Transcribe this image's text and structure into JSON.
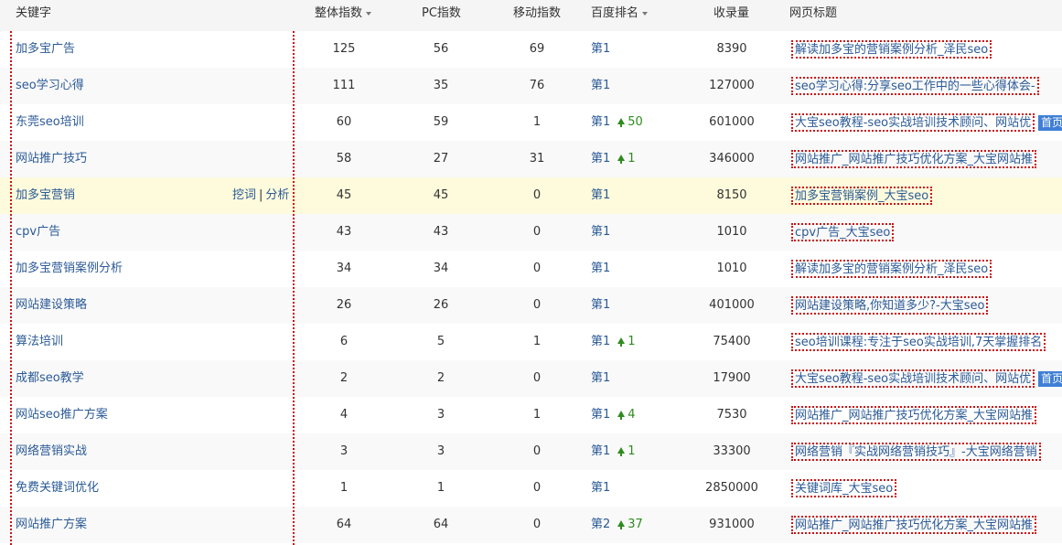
{
  "header": {
    "keyword": "关键字",
    "overall": "整体指数",
    "pc": "PC指数",
    "mobile": "移动指数",
    "rank": "百度排名",
    "indexed": "收录量",
    "page_title": "网页标题"
  },
  "row_actions": {
    "mine": "挖词",
    "sep": "|",
    "analyze": "分析"
  },
  "home_badge": "首页",
  "colors": {
    "link": "#2b5a96",
    "up": "#2e8b1e",
    "highlight": "#fdfbdc",
    "dotted_border": "#cc1111",
    "badge": "#3f7fd6"
  },
  "rows": [
    {
      "keyword": "加多宝广告",
      "overall": "125",
      "pc": "56",
      "mobile": "69",
      "rank": "第1",
      "change": "",
      "indexed": "8390",
      "title": "解读加多宝的营销案例分析_泽民seo",
      "home": false
    },
    {
      "keyword": "seo学习心得",
      "overall": "111",
      "pc": "35",
      "mobile": "76",
      "rank": "第1",
      "change": "",
      "indexed": "127000",
      "title": "seo学习心得:分享seo工作中的一些心得体会-",
      "home": false
    },
    {
      "keyword": "东莞seo培训",
      "overall": "60",
      "pc": "59",
      "mobile": "1",
      "rank": "第1",
      "change": "50",
      "indexed": "601000",
      "title": "大宝seo教程-seo实战培训技术顾问、网站优",
      "home": true
    },
    {
      "keyword": "网站推广技巧",
      "overall": "58",
      "pc": "27",
      "mobile": "31",
      "rank": "第1",
      "change": "1",
      "indexed": "346000",
      "title": "网站推广_网站推广技巧优化方案_大宝网站推",
      "home": false
    },
    {
      "keyword": "加多宝营销",
      "overall": "45",
      "pc": "45",
      "mobile": "0",
      "rank": "第1",
      "change": "",
      "indexed": "8150",
      "title": "加多宝营销案例_大宝seo",
      "home": false
    },
    {
      "keyword": "cpv广告",
      "overall": "43",
      "pc": "43",
      "mobile": "0",
      "rank": "第1",
      "change": "",
      "indexed": "1010",
      "title": "cpv广告_大宝seo",
      "home": false
    },
    {
      "keyword": "加多宝营销案例分析",
      "overall": "34",
      "pc": "34",
      "mobile": "0",
      "rank": "第1",
      "change": "",
      "indexed": "1010",
      "title": "解读加多宝的营销案例分析_泽民seo",
      "home": false
    },
    {
      "keyword": "网站建设策略",
      "overall": "26",
      "pc": "26",
      "mobile": "0",
      "rank": "第1",
      "change": "",
      "indexed": "401000",
      "title": "网站建设策略,你知道多少?-大宝seo",
      "home": false
    },
    {
      "keyword": "算法培训",
      "overall": "6",
      "pc": "5",
      "mobile": "1",
      "rank": "第1",
      "change": "1",
      "indexed": "75400",
      "title": "seo培训课程:专注于seo实战培训,7天掌握排名",
      "home": false
    },
    {
      "keyword": "成都seo教学",
      "overall": "2",
      "pc": "2",
      "mobile": "0",
      "rank": "第1",
      "change": "",
      "indexed": "17900",
      "title": "大宝seo教程-seo实战培训技术顾问、网站优",
      "home": true
    },
    {
      "keyword": "网站seo推广方案",
      "overall": "4",
      "pc": "3",
      "mobile": "1",
      "rank": "第1",
      "change": "4",
      "indexed": "7530",
      "title": "网站推广_网站推广技巧优化方案_大宝网站推",
      "home": false
    },
    {
      "keyword": "网络营销实战",
      "overall": "3",
      "pc": "3",
      "mobile": "0",
      "rank": "第1",
      "change": "1",
      "indexed": "33300",
      "title": "网络营销『实战网络营销技巧』-大宝网络营销",
      "home": false
    },
    {
      "keyword": "免费关键词优化",
      "overall": "1",
      "pc": "1",
      "mobile": "0",
      "rank": "第1",
      "change": "",
      "indexed": "2850000",
      "title": "关键词库_大宝seo",
      "home": false
    },
    {
      "keyword": "网站推广方案",
      "overall": "64",
      "pc": "64",
      "mobile": "0",
      "rank": "第2",
      "change": "37",
      "indexed": "931000",
      "title": "网站推广_网站推广技巧优化方案_大宝网站推",
      "home": false
    }
  ]
}
